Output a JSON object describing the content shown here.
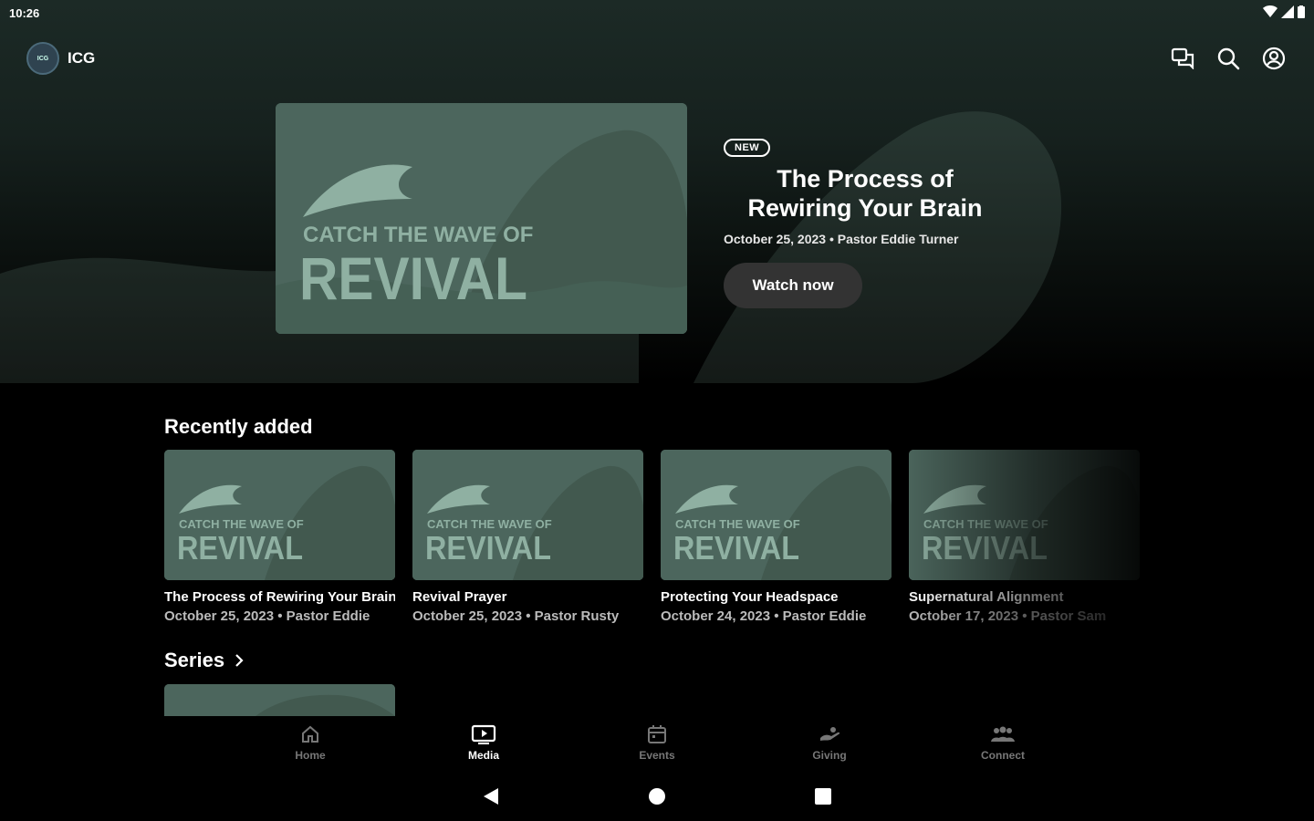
{
  "status_bar": {
    "time": "10:26"
  },
  "app": {
    "logo_text": "ICG",
    "name": "ICG"
  },
  "hero": {
    "badge": "NEW",
    "title": "The Process of Rewiring Your Brain",
    "meta": "October 25, 2023 • Pastor Eddie Turner",
    "watch_label": "Watch now",
    "art_line1": "CATCH THE WAVE OF",
    "art_line2": "REVIVAL"
  },
  "recent": {
    "title": "Recently added",
    "items": [
      {
        "title": "The Process of Rewiring Your Brain",
        "meta": "October 25, 2023 • Pastor Eddie"
      },
      {
        "title": "Revival Prayer",
        "meta": "October 25, 2023 • Pastor Rusty"
      },
      {
        "title": "Protecting Your Headspace",
        "meta": "October 24, 2023 • Pastor Eddie"
      },
      {
        "title": "Supernatural Alignment",
        "meta": "October 17, 2023 • Pastor Sam"
      }
    ]
  },
  "series": {
    "title": "Series"
  },
  "nav": {
    "items": [
      {
        "label": "Home",
        "icon": "home-icon"
      },
      {
        "label": "Media",
        "icon": "media-icon",
        "active": true
      },
      {
        "label": "Events",
        "icon": "calendar-icon"
      },
      {
        "label": "Giving",
        "icon": "giving-icon"
      },
      {
        "label": "Connect",
        "icon": "people-icon"
      }
    ]
  },
  "colors": {
    "thumb_bg": "#4c665d",
    "art_fg": "#8fb0a2",
    "header_bg": "#1c2a26",
    "button_bg": "#333333"
  }
}
